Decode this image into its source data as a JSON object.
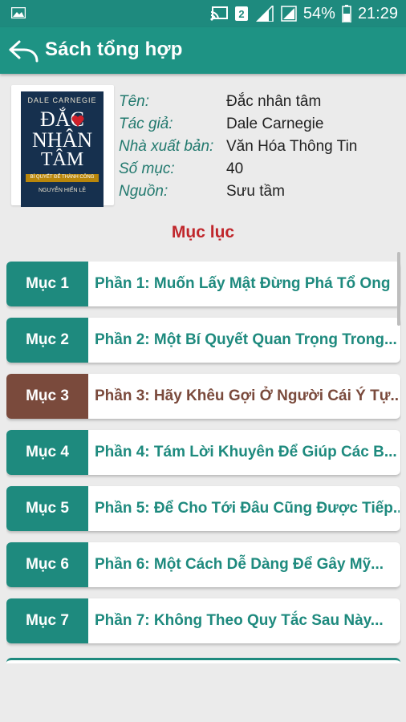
{
  "status_bar": {
    "notification_badge": "2",
    "battery": "54%",
    "time": "21:29"
  },
  "app_bar": {
    "title": "Sách tổng hợp"
  },
  "book": {
    "cover": {
      "author_line": "DALE CARNEGIE",
      "title_line1": "ĐẮC",
      "title_line2": "NHÂN",
      "title_line3": "TÂM",
      "subtitle": "BÍ QUYẾT ĐỂ THÀNH CÔNG",
      "publisher": "NGUYỄN HIẾN LÊ"
    },
    "fields": [
      {
        "label": "Tên:",
        "value": "Đắc nhân tâm"
      },
      {
        "label": "Tác giả:",
        "value": "Dale Carnegie"
      },
      {
        "label": "Nhà xuất bản:",
        "value": "Văn Hóa Thông Tin"
      },
      {
        "label": "Số mục:",
        "value": "40"
      },
      {
        "label": "Nguồn:",
        "value": "Sưu tầm"
      }
    ]
  },
  "section_title": "Mục lục",
  "colors": {
    "accent": "#1e8a7e",
    "selected": "#7a4a3c",
    "heading": "#c0262b"
  },
  "chapters": [
    {
      "badge": "Mục 1",
      "title": "Phần 1: Muốn Lấy Mật Đừng Phá Tổ Ong"
    },
    {
      "badge": "Mục 2",
      "title": "Phần 2: Một Bí Quyết Quan Trọng Trong..."
    },
    {
      "badge": "Mục 3",
      "title": "Phần 3: Hãy Khêu Gợi Ở Người Cái Ý Tự..."
    },
    {
      "badge": "Mục 4",
      "title": "Phần 4: Tám Lời Khuyên Để Giúp Các B..."
    },
    {
      "badge": "Mục 5",
      "title": "Phần 5: Để Cho Tới Đâu Cũng Được Tiếp..."
    },
    {
      "badge": "Mục 6",
      "title": "Phần 6: Một Cách Dễ Dàng Để Gây Mỹ..."
    },
    {
      "badge": "Mục 7",
      "title": "Phần 7: Không Theo Quy Tắc Sau Này..."
    }
  ]
}
